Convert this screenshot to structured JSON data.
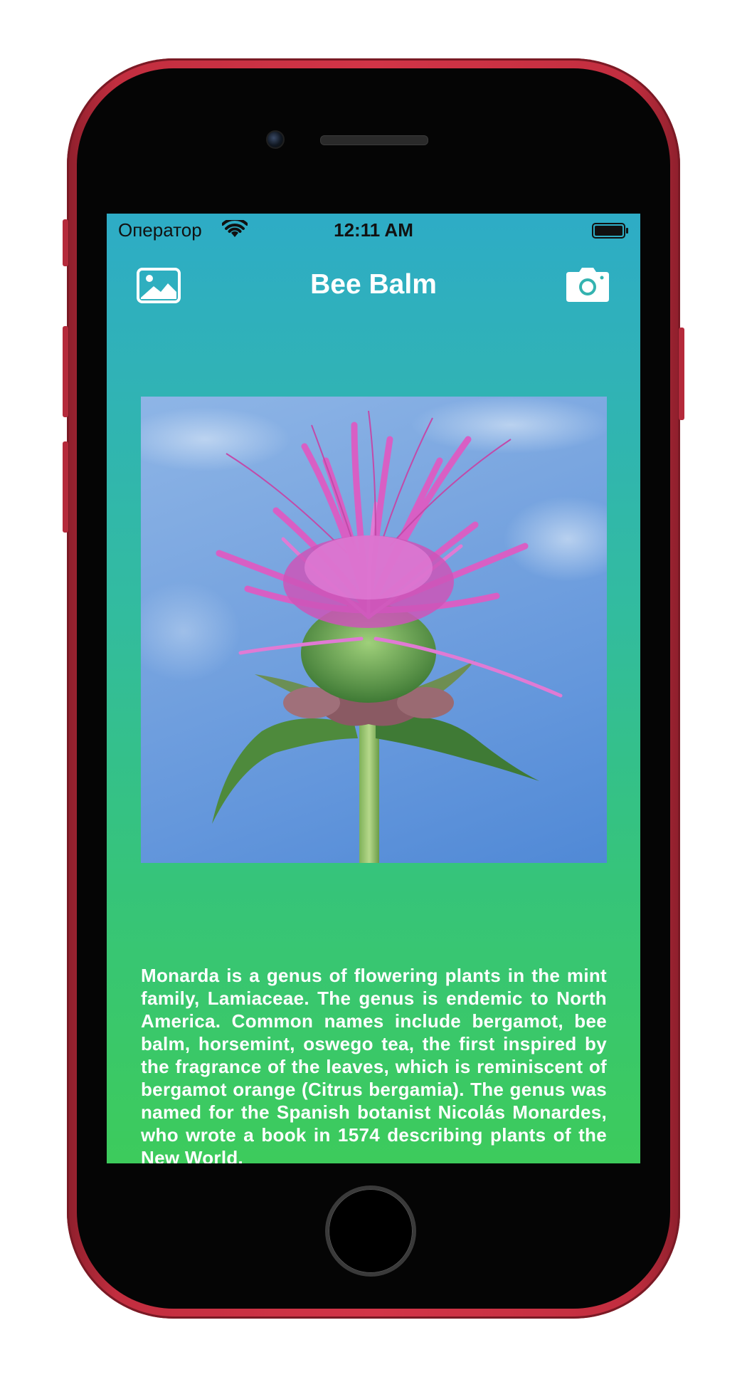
{
  "status_bar": {
    "carrier": "Оператор",
    "time": "12:11 AM"
  },
  "nav_bar": {
    "title": "Bee Balm",
    "left_icon": "photo-library-icon",
    "right_icon": "camera-icon"
  },
  "content": {
    "image_subject": "pink bee balm flower against blue sky",
    "description": "Monarda is a genus of flowering plants in the mint family, Lamiaceae. The genus is endemic to North America. Common names include bergamot, bee balm, horsemint, oswego tea, the first inspired by the fragrance of the leaves, which is reminiscent of bergamot orange (Citrus bergamia). The genus was named for the Spanish botanist Nicolás Monardes, who wrote a book in 1574 describing plants of the New World."
  },
  "colors": {
    "device_frame": "#d23447",
    "screen_gradient_top": "#2eacc6",
    "screen_gradient_bottom": "#3dcb5c",
    "title_text": "#ffffff"
  }
}
